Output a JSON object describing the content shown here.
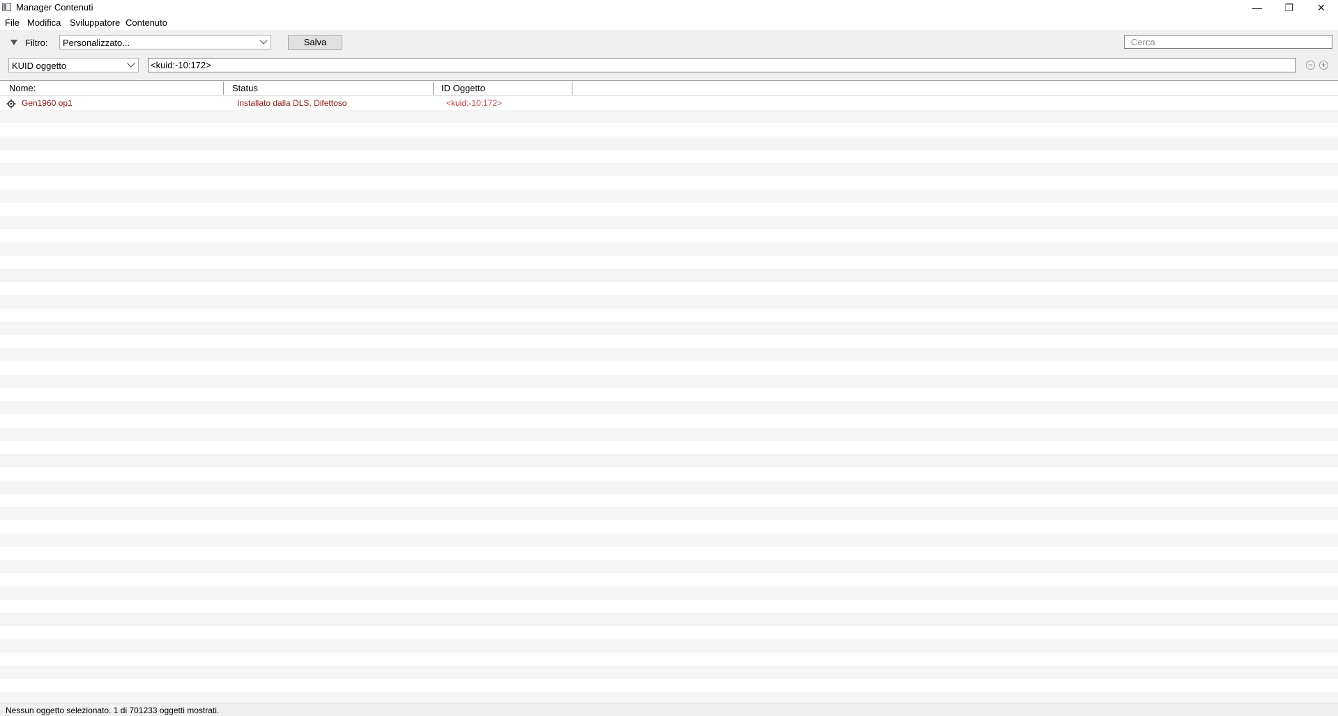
{
  "window": {
    "title": "Manager Contenuti",
    "controls": {
      "minimize": "—",
      "maximize": "❐",
      "close": "✕"
    }
  },
  "menu": [
    "File",
    "Modifica",
    "Sviluppatore",
    "Contenuto"
  ],
  "toolbar": {
    "filter_label": "Filtro:",
    "filter_value": "Personalizzato...",
    "save_label": "Salva",
    "search_placeholder": "Cerca",
    "field_select": "KUID oggetto",
    "field_value": "<kuid:-10:172>",
    "remove_symbol": "−",
    "add_symbol": "+"
  },
  "table": {
    "columns": [
      "Nome:",
      "Status",
      "ID Oggetto"
    ],
    "rows": [
      {
        "icon": "gear-icon",
        "name": "Gen1960 op1",
        "status": "Installato dalla DLS, Difettoso",
        "id": "<kuid:-10:172>"
      }
    ]
  },
  "statusbar": {
    "text": "Nessun oggetto selezionato. 1 di 701233 oggetti mostrati."
  },
  "colors": {
    "faulty_text": "#8b1a1a",
    "kuid_text": "#c05050",
    "stripe": "#f5f5f5",
    "toolbar_bg": "#f0f0f0"
  }
}
